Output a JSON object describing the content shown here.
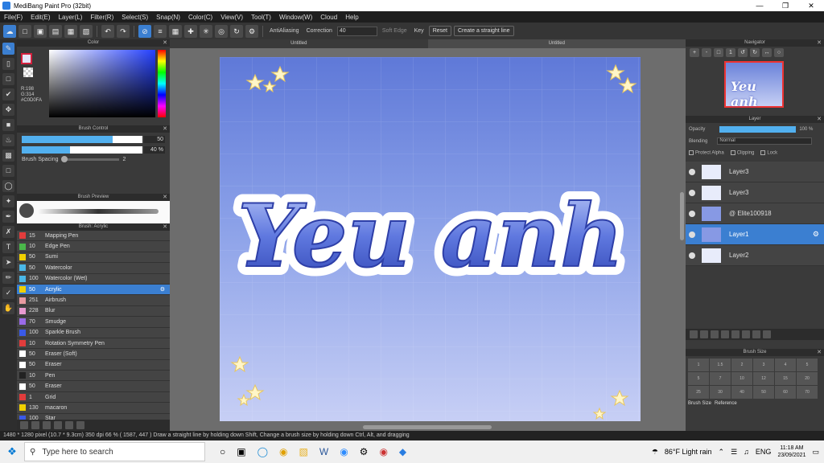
{
  "app": {
    "title": "MediBang Paint Pro (32bit)"
  },
  "menu": [
    "File(F)",
    "Edit(E)",
    "Layer(L)",
    "Filter(R)",
    "Select(S)",
    "Snap(N)",
    "Color(C)",
    "View(V)",
    "Tool(T)",
    "Window(W)",
    "Cloud",
    "Help"
  ],
  "toolbar": {
    "antialias": "AntiAliasing",
    "correction_label": "Correction",
    "correction_value": "40",
    "soft_edge": "Soft Edge",
    "key": "Key",
    "reset": "Reset",
    "straight_line": "Create a straight line"
  },
  "color_panel": {
    "title": "Color",
    "rgb": [
      "R:198",
      "G:314",
      "#C0D0FA"
    ],
    "primary_color": "#e5e6fa"
  },
  "brush_control": {
    "title": "Brush Control",
    "size": 50,
    "size_fill": 0.75,
    "opacity": "40 %",
    "opacity_fill": 0.4,
    "spacing_label": "Brush Spacing",
    "spacing": "2"
  },
  "brush_preview": {
    "title": "Brush Preview"
  },
  "brush_list": {
    "title": "Brush: Acrylic",
    "items": [
      {
        "num": "15",
        "name": "Mapping Pen",
        "color": "#e23c3c"
      },
      {
        "num": "10",
        "name": "Edge Pen",
        "color": "#4ab84a"
      },
      {
        "num": "50",
        "name": "Sumi",
        "color": "#f0d000"
      },
      {
        "num": "50",
        "name": "Watercolor",
        "color": "#4ab8e8"
      },
      {
        "num": "100",
        "name": "Watercolor (Wet)",
        "color": "#4ab8e8"
      },
      {
        "num": "50",
        "name": "Acrylic",
        "color": "#f0d000"
      },
      {
        "num": "251",
        "name": "Airbrush",
        "color": "#e89aa0"
      },
      {
        "num": "228",
        "name": "Blur",
        "color": "#e89ad0"
      },
      {
        "num": "70",
        "name": "Smudge",
        "color": "#9a6ae8"
      },
      {
        "num": "100",
        "name": "Sparkle Brush",
        "color": "#3a5ae8"
      },
      {
        "num": "10",
        "name": "Rotation Symmetry Pen",
        "color": "#e23c3c"
      },
      {
        "num": "50",
        "name": "Eraser (Soft)",
        "color": "#ffffff"
      },
      {
        "num": "50",
        "name": "Eraser",
        "color": "#ffffff"
      },
      {
        "num": "10",
        "name": "Pen",
        "color": "#222222"
      },
      {
        "num": "50",
        "name": "Eraser",
        "color": "#ffffff"
      },
      {
        "num": "1",
        "name": "Grid",
        "color": "#e23c3c"
      },
      {
        "num": "130",
        "name": "macaron",
        "color": "#f0d000"
      },
      {
        "num": "100",
        "name": "Star",
        "color": "#3a5ae8"
      }
    ],
    "active_index": 5
  },
  "canvas": {
    "tabs": [
      "Untitled",
      "Untitled"
    ],
    "art_text": "Yeu anh"
  },
  "navigator": {
    "title": "Navigator",
    "thumb_text": "Yeu anh"
  },
  "layer_panel": {
    "title": "Layer",
    "opacity_label": "Opacity",
    "opacity_value": "100 %",
    "blending_label": "Blending",
    "blending_value": "Normal",
    "protect_alpha": "Protect Alpha",
    "clipping": "Clipping",
    "lock": "Lock",
    "layers": [
      {
        "name": "Layer3"
      },
      {
        "name": "Layer3"
      },
      {
        "name": "@ Elite100918"
      },
      {
        "name": "Layer1"
      },
      {
        "name": "Layer2"
      }
    ],
    "active_index": 3
  },
  "brush_size": {
    "title": "Brush Size",
    "cells": [
      "1",
      "1.5",
      "2",
      "3",
      "4",
      "5",
      "5",
      "7",
      "10",
      "12",
      "15",
      "20",
      "25",
      "30",
      "40",
      "50",
      "60",
      "70"
    ],
    "tabs": [
      "Brush Size",
      "Reference"
    ]
  },
  "status": "1480 * 1280 pixel  (10.7 * 9.3cm)  350 dpi  66 %  ( 1587, 447 )  Draw a straight line by holding down Shift, Change a brush size by holding down Ctrl, Alt, and dragging",
  "taskbar": {
    "search_placeholder": "Type here to search",
    "weather": "86°F  Light rain",
    "lang": "ENG",
    "time": "11:18 AM",
    "date": "23/09/2021"
  }
}
